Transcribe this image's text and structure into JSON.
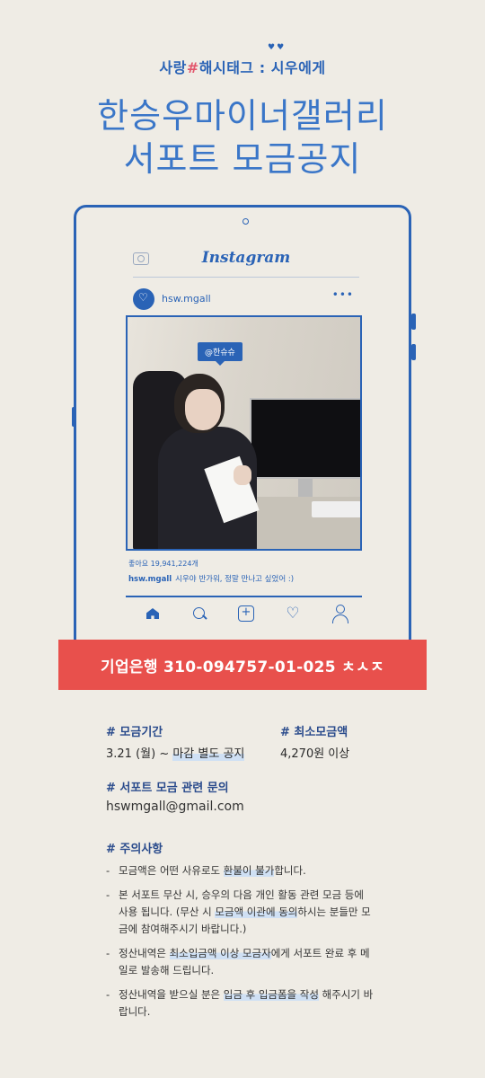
{
  "header": {
    "tagline_part1": "사랑",
    "tagline_hash": "#",
    "tagline_part2": "해시태그 : ",
    "tagline_part3": "시우에게",
    "title_line1": "한승우마이너갤러리",
    "title_line2": "서포트 모금공지"
  },
  "instagram": {
    "logo": "Instagram",
    "handle": "hsw.mgall",
    "more": "•••",
    "mention_tag": "@한슈슈",
    "likes": "좋아요 19,941,224개",
    "caption_user": "hsw.mgall",
    "caption_text": "시우야 반가워, 정말 만나고 싶었어 :)"
  },
  "bank": {
    "label": "기업은행 310-094757-01-025 ㅊㅅㅈ"
  },
  "period": {
    "title": "# 모금기간",
    "date": "3.21 (월) ~ ",
    "date_hl": "마감 별도 공지"
  },
  "minimum": {
    "title": "# 최소모금액",
    "amount": "4,270원 이상"
  },
  "inquiry": {
    "title": "# 서포트 모금 관련 문의",
    "email": "hswmgall@gmail.com"
  },
  "notice": {
    "title": "# 주의사항",
    "item1_a": "모금액은 어떤 사유로도 ",
    "item1_hl": "환불이 불가",
    "item1_b": "합니다.",
    "item2_a": "본 서포트 무산 시, 승우의 다음 개인 활동 관련 모금 등에 사용 됩니다. (무산 시 ",
    "item2_hl": "모금액 이관에 동의",
    "item2_b": "하시는 분들만 모금에 참여해주시기 바랍니다.)",
    "item3_a": "정산내역은 ",
    "item3_hl": "최소입금액 이상 모금자",
    "item3_b": "에게 서포트 완료 후 메일로 발송해 드립니다.",
    "item4_a": "정산내역을 받으실 분은 ",
    "item4_hl": "입금 후 입금폼을 작성",
    "item4_b": " 해주시기 바랍니다."
  },
  "colors": {
    "accent": "#2a63b6",
    "banner": "#e8504c",
    "background": "#efece5"
  }
}
